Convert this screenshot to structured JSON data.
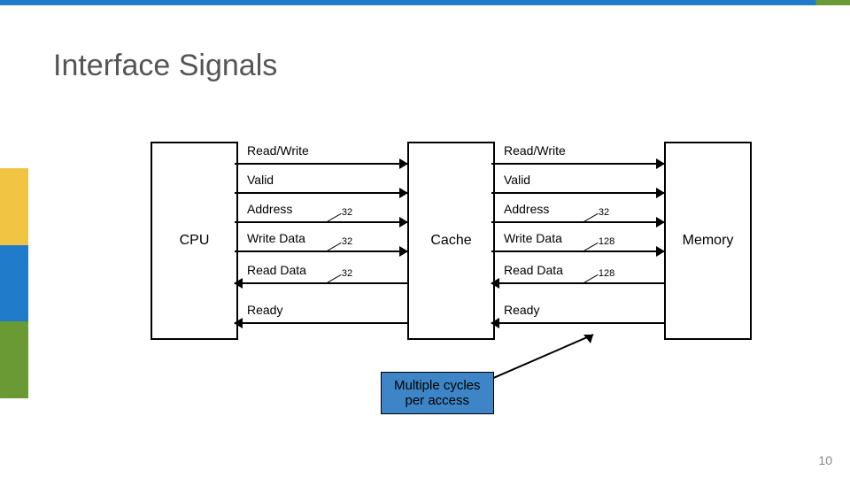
{
  "title": "Interface Signals",
  "blocks": {
    "cpu": "CPU",
    "cache": "Cache",
    "memory": "Memory"
  },
  "left_signals": [
    {
      "label": "Read/Write",
      "dir": "r",
      "width": ""
    },
    {
      "label": "Valid",
      "dir": "r",
      "width": ""
    },
    {
      "label": "Address",
      "dir": "r",
      "width": "32"
    },
    {
      "label": "Write Data",
      "dir": "r",
      "width": "32"
    },
    {
      "label": "Read Data",
      "dir": "l",
      "width": "32"
    },
    {
      "label": "Ready",
      "dir": "l",
      "width": ""
    }
  ],
  "right_signals": [
    {
      "label": "Read/Write",
      "dir": "r",
      "width": ""
    },
    {
      "label": "Valid",
      "dir": "r",
      "width": ""
    },
    {
      "label": "Address",
      "dir": "r",
      "width": "32"
    },
    {
      "label": "Write Data",
      "dir": "r",
      "width": "128"
    },
    {
      "label": "Read Data",
      "dir": "l",
      "width": "128"
    },
    {
      "label": "Ready",
      "dir": "l",
      "width": ""
    }
  ],
  "note": "Multiple cycles\nper access",
  "page": "10"
}
